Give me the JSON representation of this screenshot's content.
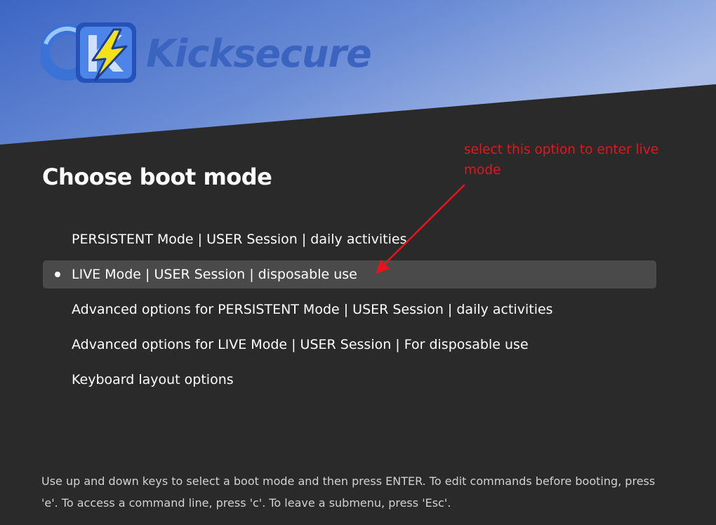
{
  "brand": {
    "name": "Kicksecure",
    "logo_icon": "kicksecure-logo-icon"
  },
  "page": {
    "title": "Choose boot mode"
  },
  "annotation": {
    "text": "select this option to enter live mode",
    "color": "#e8141c"
  },
  "menu": {
    "selected_index": 1,
    "items": [
      {
        "label": "PERSISTENT Mode | USER Session | daily activities",
        "selected": false
      },
      {
        "label": "LIVE Mode | USER Session | disposable use",
        "selected": true
      },
      {
        "label": "Advanced options for PERSISTENT Mode | USER Session | daily activities",
        "selected": false
      },
      {
        "label": "Advanced options for LIVE Mode | USER Session | For disposable use",
        "selected": false
      },
      {
        "label": "Keyboard layout options",
        "selected": false
      }
    ]
  },
  "help": {
    "text": "Use up and down keys to select a boot mode and then press ENTER. To edit commands before booting, press 'e'. To access a command line, press 'c'. To leave a submenu, press 'Esc'."
  },
  "colors": {
    "background": "#2a2a2a",
    "header_gradient_start": "#3c66c4",
    "header_gradient_end": "#a4b8e6",
    "brand_text": "#3a64bf",
    "selected_row": "#4a4a4a"
  }
}
